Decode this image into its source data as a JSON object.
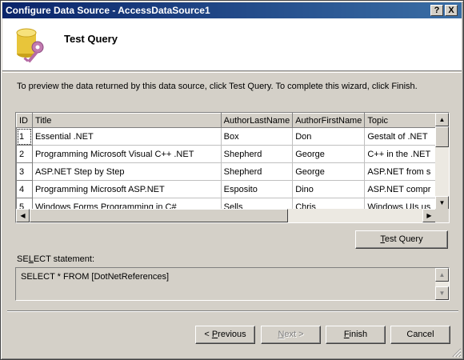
{
  "window": {
    "title": "Configure Data Source - AccessDataSource1",
    "help_glyph": "?",
    "close_glyph": "X"
  },
  "header": {
    "title": "Test Query",
    "icon": "database-key-icon"
  },
  "description": "To preview the data returned by this data source, click Test Query. To complete this wizard, click Finish.",
  "grid": {
    "columns": [
      "ID",
      "Title",
      "AuthorLastName",
      "AuthorFirstName",
      "Topic"
    ],
    "rows": [
      [
        "1",
        "Essential .NET",
        "Box",
        "Don",
        "Gestalt of .NET"
      ],
      [
        "2",
        "Programming Microsoft Visual C++ .NET",
        "Shepherd",
        "George",
        "C++ in the .NET"
      ],
      [
        "3",
        "ASP.NET Step by Step",
        "Shepherd",
        "George",
        "ASP.NET from s"
      ],
      [
        "4",
        "Programming Microsoft ASP.NET",
        "Esposito",
        "Dino",
        "ASP.NET compr"
      ],
      [
        "5",
        "Windows Forms Programming in C#",
        "Sells",
        "Chris",
        "Windows UIs us"
      ]
    ]
  },
  "test_query_button": {
    "label_u": "T",
    "label_rest": "est Query"
  },
  "select_label": {
    "pre": "SE",
    "u": "L",
    "post": "ECT statement:"
  },
  "sql": "SELECT * FROM [DotNetReferences]",
  "buttons": {
    "previous": {
      "pre": "< ",
      "u": "P",
      "post": "revious"
    },
    "next": {
      "u": "N",
      "post": "ext >"
    },
    "finish": {
      "u": "F",
      "post": "inish"
    },
    "cancel": "Cancel"
  },
  "colors": {
    "title_start": "#0a246a",
    "title_end": "#3a6ea5",
    "face": "#d4d0c8"
  }
}
